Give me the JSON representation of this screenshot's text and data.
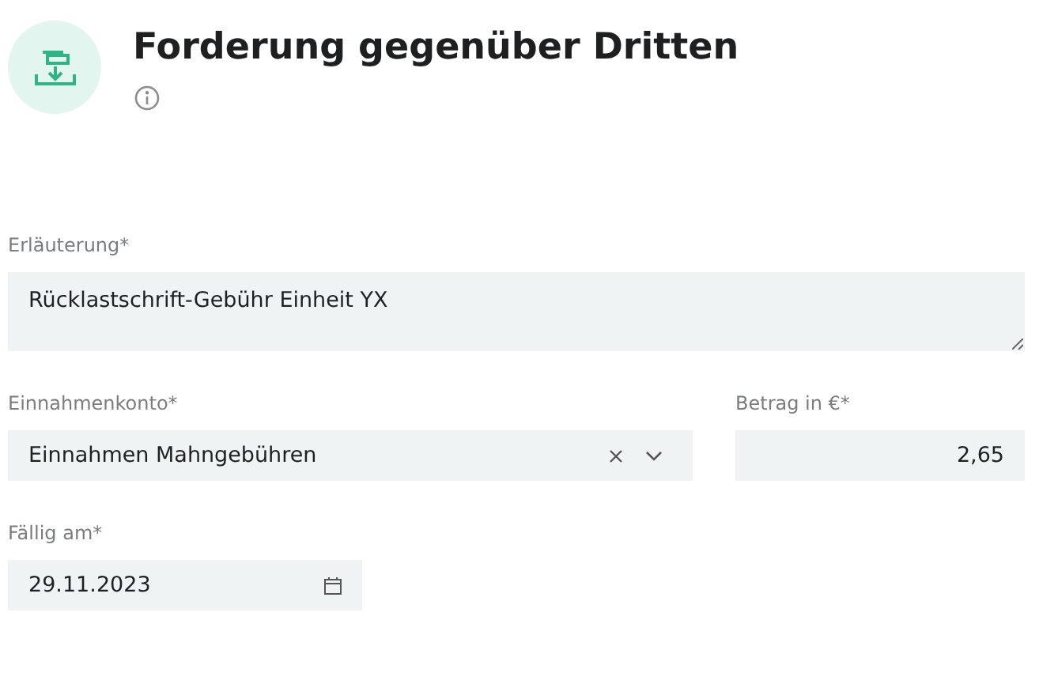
{
  "header": {
    "title": "Forderung gegenüber Dritten"
  },
  "fields": [
    {
      "kind": "textarea",
      "label": "Erläuterung*",
      "value": "Rücklastschrift-Gebühr Einheit YX"
    },
    {
      "kind": "select",
      "label": "Einnahmenkonto*",
      "value": "Einnahmen Mahngebühren"
    },
    {
      "kind": "amount",
      "label": "Betrag in €*",
      "value": "2,65"
    },
    {
      "kind": "date",
      "label": "Fällig am*",
      "value": "29.11.2023"
    }
  ]
}
